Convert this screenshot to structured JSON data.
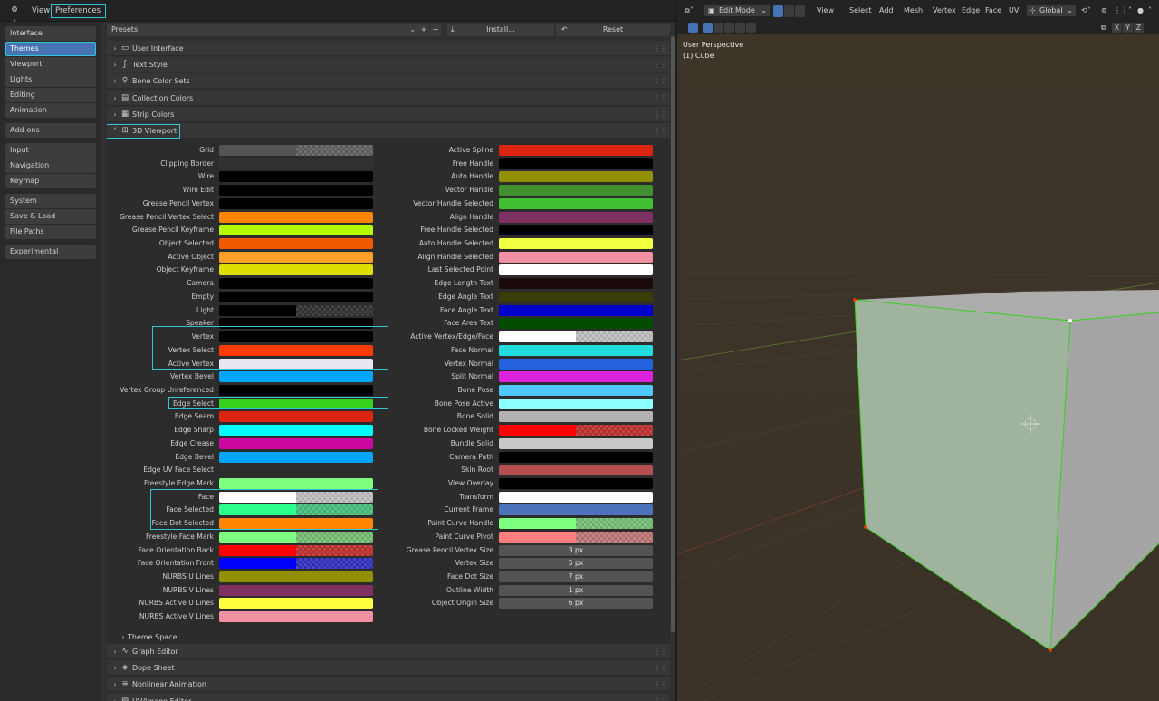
{
  "prefs_header": {
    "gear_icon": "gear-icon",
    "view_menu": "View",
    "preferences_menu": "Preferences"
  },
  "nav": [
    {
      "label": "Interface",
      "active": false,
      "highlighted": false
    },
    {
      "label": "Themes",
      "active": true,
      "highlighted": true
    },
    {
      "label": "Viewport",
      "active": false,
      "highlighted": false
    },
    {
      "label": "Lights",
      "active": false,
      "highlighted": false
    },
    {
      "label": "Editing",
      "active": false,
      "highlighted": false
    },
    {
      "label": "Animation",
      "active": false,
      "highlighted": false
    },
    {
      "label": "Add-ons",
      "active": false,
      "highlighted": false
    },
    {
      "label": "Input",
      "active": false,
      "highlighted": false
    },
    {
      "label": "Navigation",
      "active": false,
      "highlighted": false
    },
    {
      "label": "Keymap",
      "active": false,
      "highlighted": false
    },
    {
      "label": "System",
      "active": false,
      "highlighted": false
    },
    {
      "label": "Save & Load",
      "active": false,
      "highlighted": false
    },
    {
      "label": "File Paths",
      "active": false,
      "highlighted": false
    },
    {
      "label": "Experimental",
      "active": false,
      "highlighted": false
    }
  ],
  "presets": {
    "label": "Presets",
    "add": "+",
    "remove": "−",
    "install_label": "Install...",
    "reset_label": "Reset"
  },
  "sections_top": [
    {
      "label": "User Interface",
      "icon": "monitor-icon"
    },
    {
      "label": "Text Style",
      "icon": "text-style-icon"
    },
    {
      "label": "Bone Color Sets",
      "icon": "bone-icon"
    },
    {
      "label": "Collection Colors",
      "icon": "collection-icon"
    },
    {
      "label": "Strip Colors",
      "icon": "strip-icon"
    }
  ],
  "viewport_section": {
    "label": "3D Viewport",
    "icon": "viewport-icon",
    "expanded": true
  },
  "left_props": [
    {
      "label": "Grid",
      "color": "#545454",
      "alpha": 0.5
    },
    {
      "label": "Clipping Border",
      "color": "#313131",
      "alpha": 1
    },
    {
      "label": "Wire",
      "color": "#000000",
      "alpha": 1
    },
    {
      "label": "Wire Edit",
      "color": "#000000",
      "alpha": 1
    },
    {
      "label": "Grease Pencil Vertex",
      "color": "#000000",
      "alpha": 1
    },
    {
      "label": "Grease Pencil Vertex Select",
      "color": "#ff8500",
      "alpha": 1
    },
    {
      "label": "Grease Pencil Keyframe",
      "color": "#b3ff00",
      "alpha": 1
    },
    {
      "label": "Object Selected",
      "color": "#f15800",
      "alpha": 1
    },
    {
      "label": "Active Object",
      "color": "#ffa028",
      "alpha": 1
    },
    {
      "label": "Object Keyframe",
      "color": "#dddd00",
      "alpha": 1
    },
    {
      "label": "Camera",
      "color": "#000000",
      "alpha": 1
    },
    {
      "label": "Empty",
      "color": "#000000",
      "alpha": 1
    },
    {
      "label": "Light",
      "color": "#000000",
      "alpha": 0.5
    },
    {
      "label": "Speaker",
      "color": "#000000",
      "alpha": 1
    },
    {
      "label": "Vertex",
      "color": "#000000",
      "alpha": 1
    },
    {
      "label": "Vertex Select",
      "color": "#ff3b00",
      "alpha": 1
    },
    {
      "label": "Active Vertex",
      "color": "#e7e7ef",
      "alpha": 1
    },
    {
      "label": "Vertex Bevel",
      "color": "#00a5ff",
      "alpha": 1
    },
    {
      "label": "Vertex Group Unreferenced",
      "color": "#000000",
      "alpha": 1
    },
    {
      "label": "Edge Select",
      "color": "#37d01c",
      "alpha": 1
    },
    {
      "label": "Edge Seam",
      "color": "#db2512",
      "alpha": 1
    },
    {
      "label": "Edge Sharp",
      "color": "#00ffff",
      "alpha": 1
    },
    {
      "label": "Edge Crease",
      "color": "#cc099f",
      "alpha": 1
    },
    {
      "label": "Edge Bevel",
      "color": "#00a5ff",
      "alpha": 1
    },
    {
      "label": "Edge UV Face Select",
      "color": "#2d2d2d",
      "alpha": 1
    },
    {
      "label": "Freestyle Edge Mark",
      "color": "#7fff7f",
      "alpha": 1
    },
    {
      "label": "Face",
      "color": "#ffffff",
      "alpha": 0.5
    },
    {
      "label": "Face Selected",
      "color": "#2aff8c",
      "alpha": 0.5
    },
    {
      "label": "Face Dot Selected",
      "color": "#ff8500",
      "alpha": 1
    },
    {
      "label": "Freestyle Face Mark",
      "color": "#7fff7f",
      "alpha": 0.5
    },
    {
      "label": "Face Orientation Back",
      "color": "#ff0000",
      "alpha": 0.5
    },
    {
      "label": "Face Orientation Front",
      "color": "#0000ff",
      "alpha": 0.5
    },
    {
      "label": "NURBS U Lines",
      "color": "#909000",
      "alpha": 1
    },
    {
      "label": "NURBS V Lines",
      "color": "#803060",
      "alpha": 1
    },
    {
      "label": "NURBS Active U Lines",
      "color": "#ffff40",
      "alpha": 1
    },
    {
      "label": "NURBS Active V Lines",
      "color": "#f090a0",
      "alpha": 1
    }
  ],
  "right_props": [
    {
      "label": "Active Spline",
      "color": "#db2512",
      "alpha": 1
    },
    {
      "label": "Free Handle",
      "color": "#000000",
      "alpha": 1
    },
    {
      "label": "Auto Handle",
      "color": "#909000",
      "alpha": 1
    },
    {
      "label": "Vector Handle",
      "color": "#409030",
      "alpha": 1
    },
    {
      "label": "Vector Handle Selected",
      "color": "#40c030",
      "alpha": 1
    },
    {
      "label": "Align Handle",
      "color": "#803060",
      "alpha": 1
    },
    {
      "label": "Free Handle Selected",
      "color": "#000000",
      "alpha": 1
    },
    {
      "label": "Auto Handle Selected",
      "color": "#f0ff40",
      "alpha": 1
    },
    {
      "label": "Align Handle Selected",
      "color": "#f090a0",
      "alpha": 1
    },
    {
      "label": "Last Selected Point",
      "color": "#ffffff",
      "alpha": 1
    },
    {
      "label": "Edge Length Text",
      "color": "#1a0a0a",
      "alpha": 1
    },
    {
      "label": "Edge Angle Text",
      "color": "#3b3b0a",
      "alpha": 1
    },
    {
      "label": "Face Angle Text",
      "color": "#0000cc",
      "alpha": 1
    },
    {
      "label": "Face Area Text",
      "color": "#004d00",
      "alpha": 1
    },
    {
      "label": "Active Vertex/Edge/Face",
      "color": "#ffffff",
      "alpha": 0.5
    },
    {
      "label": "Face Normal",
      "color": "#22dddd",
      "alpha": 1
    },
    {
      "label": "Vertex Normal",
      "color": "#2361dd",
      "alpha": 1
    },
    {
      "label": "Split Normal",
      "color": "#dd23dd",
      "alpha": 1
    },
    {
      "label": "Bone Pose",
      "color": "#50c8ff",
      "alpha": 1
    },
    {
      "label": "Bone Pose Active",
      "color": "#8cffff",
      "alpha": 1
    },
    {
      "label": "Bone Solid",
      "color": "#b2b2b2",
      "alpha": 1
    },
    {
      "label": "Bone Locked Weight",
      "color": "#ff0000",
      "alpha": 0.5
    },
    {
      "label": "Bundle Solid",
      "color": "#c8c8c8",
      "alpha": 1
    },
    {
      "label": "Camera Path",
      "color": "#000000",
      "alpha": 1
    },
    {
      "label": "Skin Root",
      "color": "#b44d4d",
      "alpha": 1
    },
    {
      "label": "View Overlay",
      "color": "#000000",
      "alpha": 1
    },
    {
      "label": "Transform",
      "color": "#ffffff",
      "alpha": 1
    },
    {
      "label": "Current Frame",
      "color": "#4e72bb",
      "alpha": 1
    },
    {
      "label": "Paint Curve Handle",
      "color": "#7fff7f",
      "alpha": 0.5
    },
    {
      "label": "Paint Curve Pivot",
      "color": "#ff7f7f",
      "alpha": 0.5
    }
  ],
  "right_sizes": [
    {
      "label": "Grease Pencil Vertex Size",
      "value": "3 px"
    },
    {
      "label": "Vertex Size",
      "value": "5 px"
    },
    {
      "label": "Face Dot Size",
      "value": "7 px"
    },
    {
      "label": "Outline Width",
      "value": "1 px"
    },
    {
      "label": "Object Origin Size",
      "value": "6 px"
    }
  ],
  "theme_space": {
    "label": "Theme Space"
  },
  "sections_bottom": [
    {
      "label": "Graph Editor",
      "icon": "graph-icon"
    },
    {
      "label": "Dope Sheet",
      "icon": "dopesheet-icon"
    },
    {
      "label": "Nonlinear Animation",
      "icon": "nla-icon"
    },
    {
      "label": "UV/Image Editor",
      "icon": "image-icon"
    }
  ],
  "viewport": {
    "mode": "Edit Mode",
    "menus": [
      "View",
      "Select",
      "Add",
      "Mesh",
      "Vertex",
      "Edge",
      "Face",
      "UV"
    ],
    "orientation": "Global",
    "axes": [
      "X",
      "Y",
      "Z"
    ],
    "overlay_line1": "User Perspective",
    "overlay_line2": "(1) Cube",
    "colors": {
      "background": "#3d3528",
      "cube_front": "#9fb39f",
      "cube_side": "#a5a5a5",
      "cube_top": "#acacac",
      "edge_select": "#37d01c",
      "vertex_select": "#ff3b00",
      "active_vertex": "#ffffff"
    }
  }
}
